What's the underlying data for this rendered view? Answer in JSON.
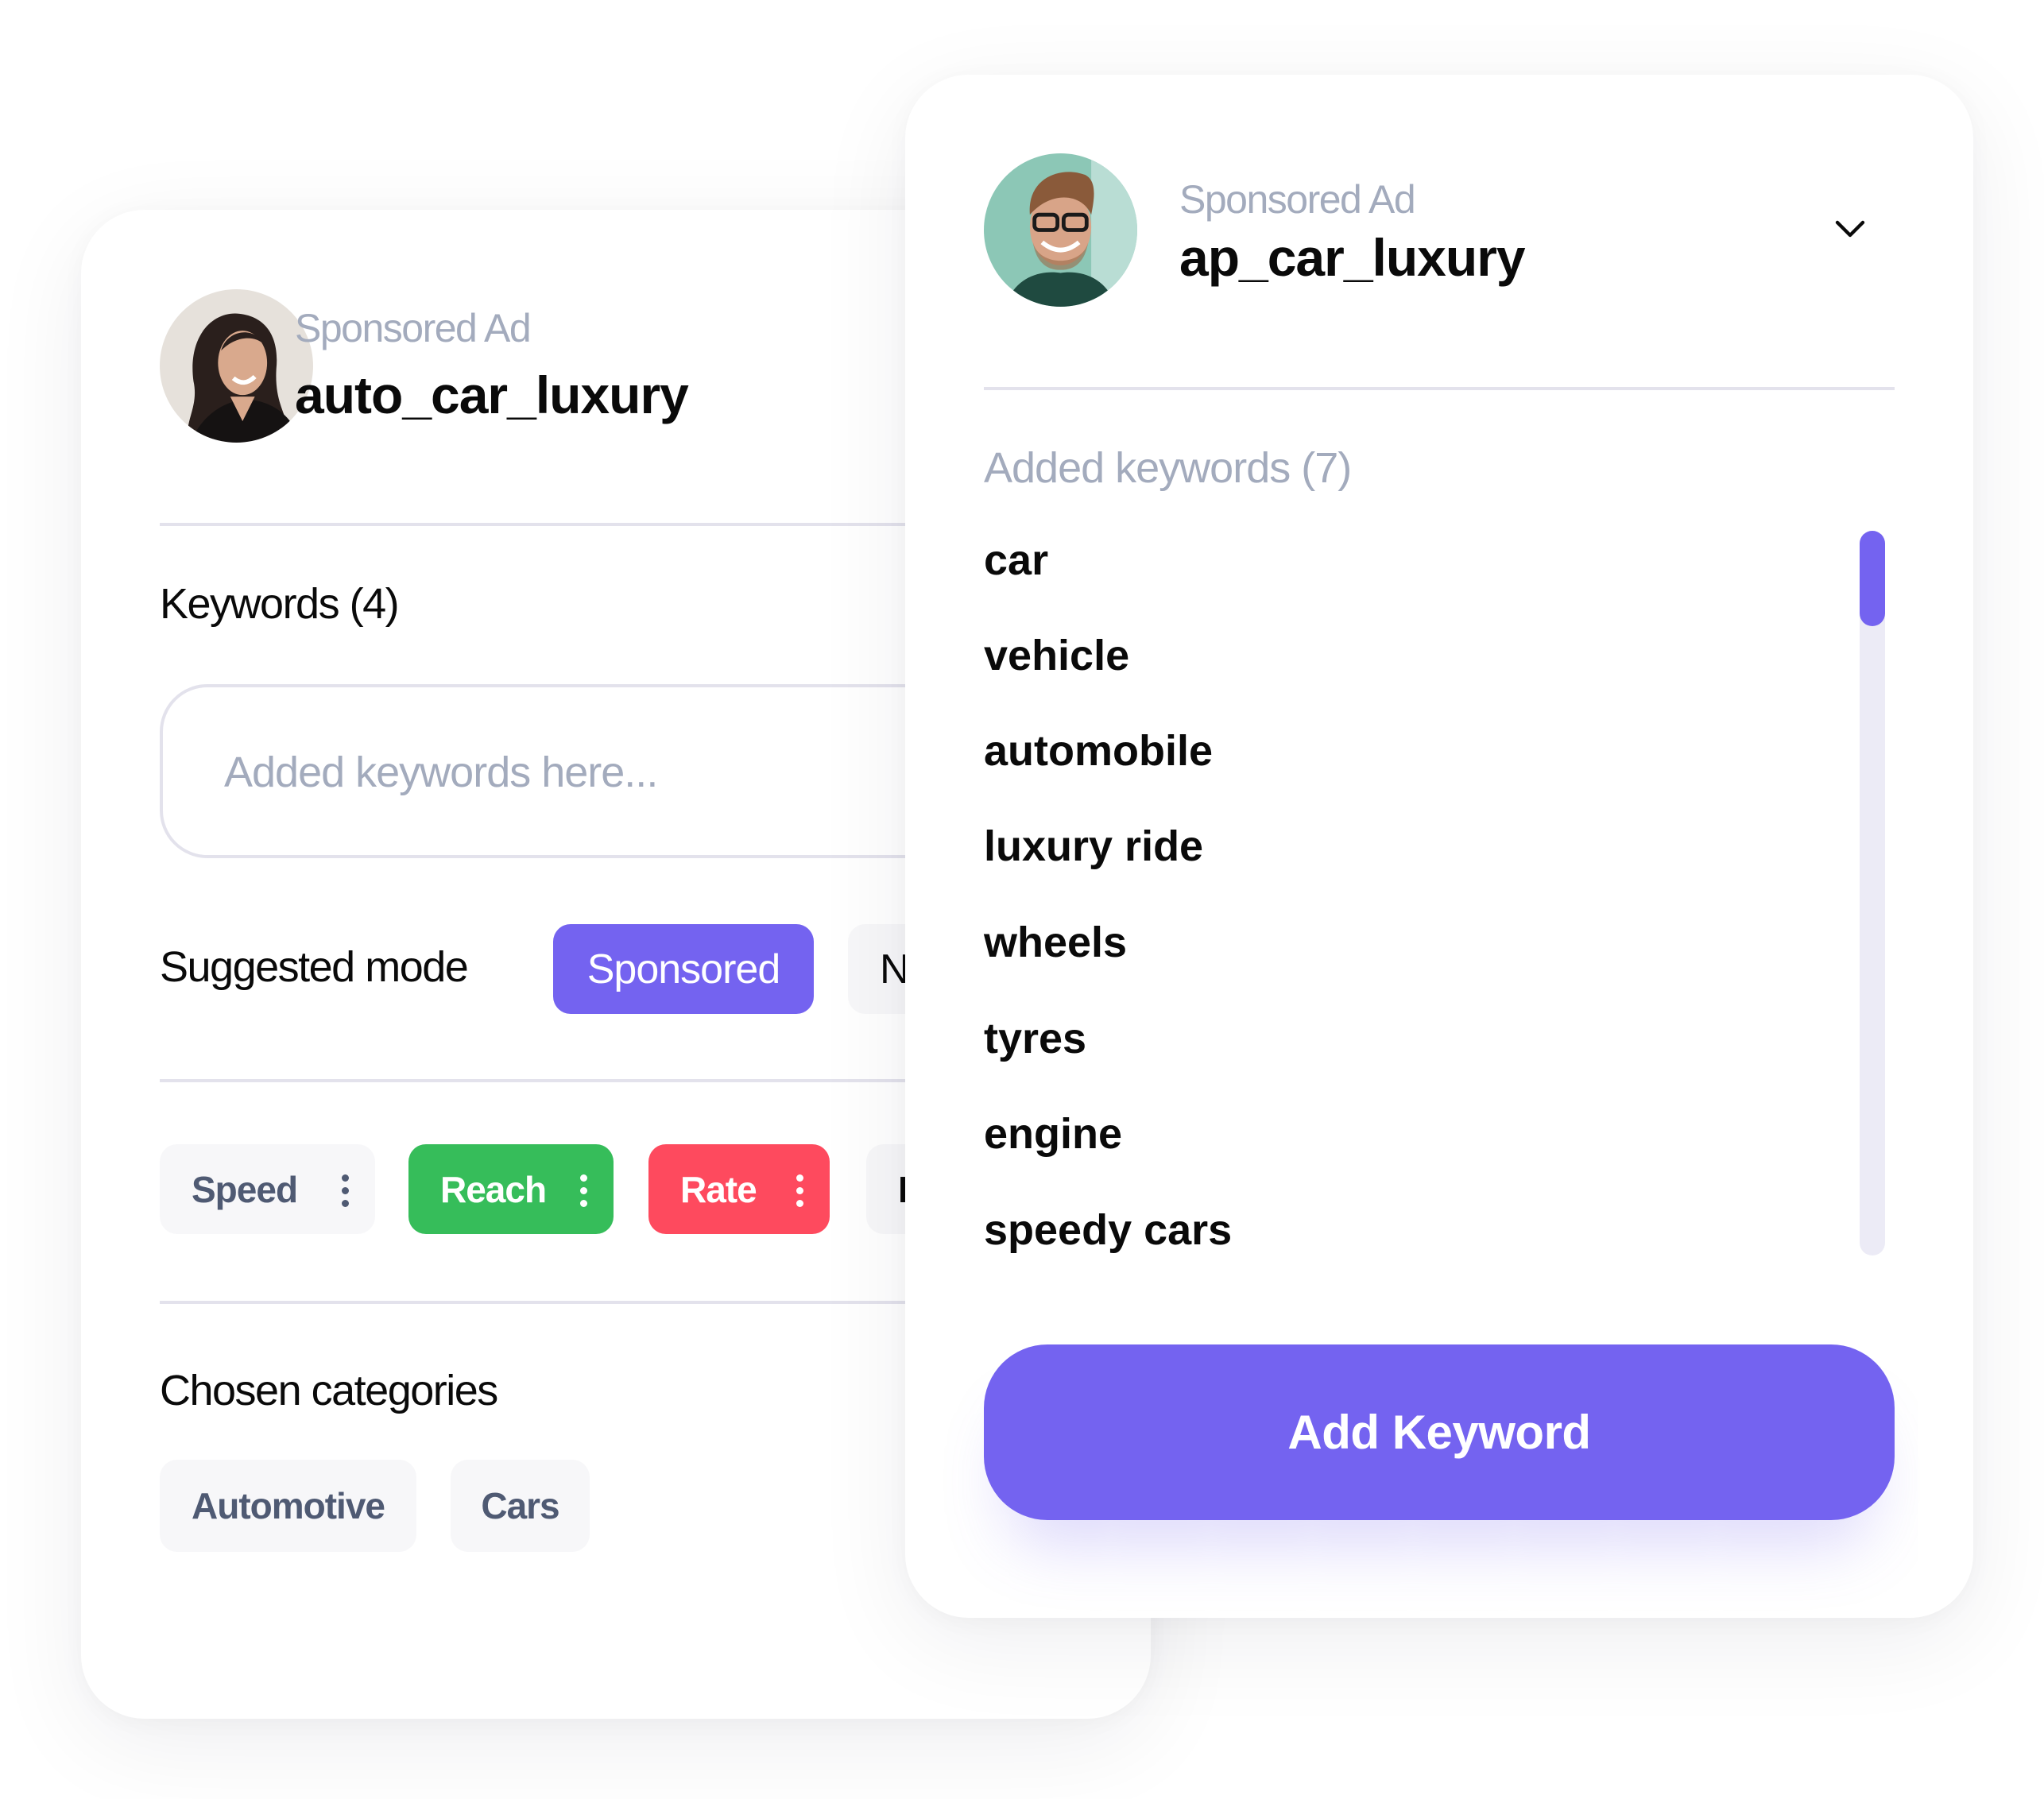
{
  "left_card": {
    "ad_label": "Sponsored Ad",
    "handle": "auto_car_luxury",
    "keywords_heading": "Keywords (4)",
    "keywords_input": {
      "value": "",
      "placeholder": "Added keywords here..."
    },
    "suggested_mode": {
      "label": "Suggested mode",
      "options": [
        {
          "label": "Sponsored",
          "selected": true
        },
        {
          "label": "N",
          "selected": false
        }
      ]
    },
    "metric_chips": [
      {
        "label": "Speed",
        "color": "#f7f7f9",
        "text_color": "#4f5a73"
      },
      {
        "label": "Reach",
        "color": "#36bd5a",
        "text_color": "#ffffff"
      },
      {
        "label": "Rate",
        "color": "#fe4a5e",
        "text_color": "#ffffff"
      },
      {
        "label": "I",
        "color": "#f7f7f9",
        "text_color": "#0a0a0a"
      }
    ],
    "categories_heading": "Chosen categories",
    "categories": [
      "Automotive",
      "Cars"
    ]
  },
  "right_card": {
    "ad_label": "Sponsored Ad",
    "handle": "ap_car_luxury",
    "dropdown_icon": "chevron-down-icon",
    "added_keywords_heading": "Added keywords (7)",
    "keywords": [
      "car",
      "vehicle",
      "automobile",
      "luxury ride",
      "wheels",
      "tyres",
      "engine",
      "speedy cars"
    ],
    "scroll_position": 0,
    "add_button_label": "Add Keyword"
  },
  "colors": {
    "accent": "#7463f0",
    "success": "#36bd5a",
    "danger": "#fe4a5e",
    "muted_text": "#a3abbd",
    "divider": "#e3e2ec"
  }
}
